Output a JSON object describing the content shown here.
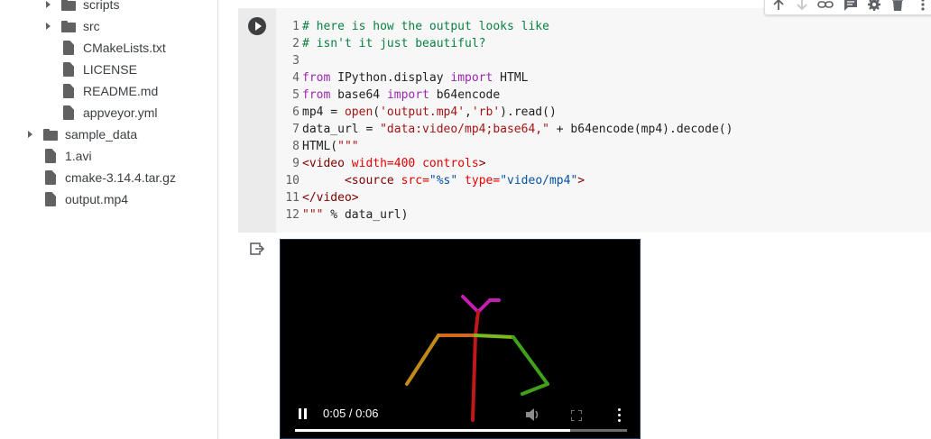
{
  "file_tree": {
    "items": [
      {
        "label": "scripts",
        "kind": "folder",
        "expandable": true,
        "depth": 1
      },
      {
        "label": "src",
        "kind": "folder",
        "expandable": true,
        "depth": 1
      },
      {
        "label": "CMakeLists.txt",
        "kind": "file",
        "expandable": false,
        "depth": 1
      },
      {
        "label": "LICENSE",
        "kind": "file",
        "expandable": false,
        "depth": 1
      },
      {
        "label": "README.md",
        "kind": "file",
        "expandable": false,
        "depth": 1
      },
      {
        "label": "appveyor.yml",
        "kind": "file",
        "expandable": false,
        "depth": 1
      },
      {
        "label": "sample_data",
        "kind": "folder",
        "expandable": true,
        "depth": 0
      },
      {
        "label": "1.avi",
        "kind": "file",
        "expandable": false,
        "depth": 0
      },
      {
        "label": "cmake-3.14.4.tar.gz",
        "kind": "file",
        "expandable": false,
        "depth": 0
      },
      {
        "label": "output.mp4",
        "kind": "file",
        "expandable": false,
        "depth": 0
      }
    ]
  },
  "code_cell": {
    "lines": [
      {
        "num": "1",
        "tokens": [
          {
            "c": "comment",
            "t": "# here is how the output looks like"
          }
        ]
      },
      {
        "num": "2",
        "tokens": [
          {
            "c": "comment",
            "t": "# isn't it just beautiful?"
          }
        ]
      },
      {
        "num": "3",
        "tokens": []
      },
      {
        "num": "4",
        "tokens": [
          {
            "c": "keyword",
            "t": "from"
          },
          {
            "c": "plain",
            "t": " IPython.display "
          },
          {
            "c": "keyword",
            "t": "import"
          },
          {
            "c": "plain",
            "t": " HTML"
          }
        ]
      },
      {
        "num": "5",
        "tokens": [
          {
            "c": "keyword",
            "t": "from"
          },
          {
            "c": "plain",
            "t": " base64 "
          },
          {
            "c": "keyword",
            "t": "import"
          },
          {
            "c": "plain",
            "t": " b64encode"
          }
        ]
      },
      {
        "num": "6",
        "tokens": [
          {
            "c": "plain",
            "t": "mp4 = "
          },
          {
            "c": "string",
            "t": "open"
          },
          {
            "c": "plain",
            "t": "("
          },
          {
            "c": "string",
            "t": "'output.mp4'"
          },
          {
            "c": "plain",
            "t": ","
          },
          {
            "c": "string",
            "t": "'rb'"
          },
          {
            "c": "plain",
            "t": ").read()"
          }
        ]
      },
      {
        "num": "7",
        "tokens": [
          {
            "c": "plain",
            "t": "data_url = "
          },
          {
            "c": "string",
            "t": "\"data:video/mp4;base64,\""
          },
          {
            "c": "plain",
            "t": " + b64encode(mp4).decode()"
          }
        ]
      },
      {
        "num": "8",
        "tokens": [
          {
            "c": "plain",
            "t": "HTML("
          },
          {
            "c": "string",
            "t": "\"\"\""
          }
        ]
      },
      {
        "num": "9",
        "tokens": [
          {
            "c": "tag",
            "t": "<video "
          },
          {
            "c": "attr",
            "t": "width=400 controls"
          },
          {
            "c": "tag",
            "t": ">"
          }
        ]
      },
      {
        "num": "10",
        "tokens": [
          {
            "c": "plain",
            "t": "      "
          },
          {
            "c": "tag",
            "t": "<source "
          },
          {
            "c": "attr",
            "t": "src="
          },
          {
            "c": "val",
            "t": "\"%s\""
          },
          {
            "c": "attr",
            "t": " type="
          },
          {
            "c": "val",
            "t": "\"video/mp4\""
          },
          {
            "c": "tag",
            "t": ">"
          }
        ]
      },
      {
        "num": "11",
        "tokens": [
          {
            "c": "tag",
            "t": "</video>"
          }
        ]
      },
      {
        "num": "12",
        "tokens": [
          {
            "c": "string",
            "t": "\"\"\""
          },
          {
            "c": "plain",
            "t": " % data_url)"
          }
        ]
      }
    ]
  },
  "toolbar": {
    "icons": [
      "arrow-up-icon",
      "arrow-down-icon",
      "link-icon",
      "comment-icon",
      "gear-icon",
      "trash-icon",
      "more-vert-icon"
    ]
  },
  "video": {
    "time": "0:05 / 0:06",
    "progress_fraction": 0.83
  },
  "colors": {
    "skeleton_head": "#c21fb0",
    "skeleton_spine": "#c0181b",
    "skeleton_shoulder_left": "#d2691e",
    "skeleton_shoulder_right": "#7dba1e",
    "skeleton_arm_left": "#c08a1a",
    "skeleton_arm_right": "#3fa01a"
  }
}
